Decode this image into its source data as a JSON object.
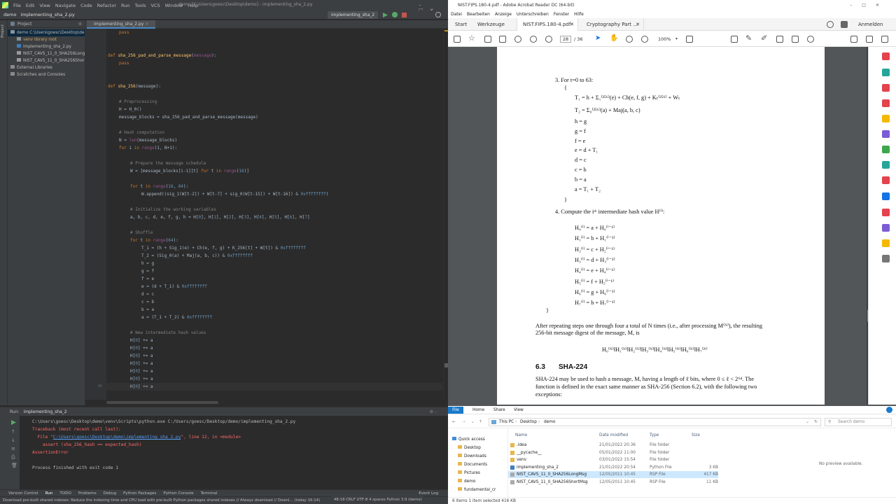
{
  "ide": {
    "menu": [
      "File",
      "Edit",
      "View",
      "Navigate",
      "Code",
      "Refactor",
      "Run",
      "Tools",
      "VCS",
      "Window",
      "Help"
    ],
    "window_title": "demo [C:\\Users\\goesc\\Desktop\\demo] - implementing_sha_2.py",
    "breadcrumb": [
      "demo",
      "implementing_sha_2.py"
    ],
    "project": {
      "header": "Project",
      "tree": [
        {
          "label": "demo  C:\\Users\\goesc\\Desktop\\demo",
          "indent": 0,
          "kind": "folder"
        },
        {
          "label": "venv  library root",
          "indent": 1,
          "kind": "folder"
        },
        {
          "label": "implementing_sha_2.py",
          "indent": 1,
          "kind": "py"
        },
        {
          "label": "NIST_CAVS_11_0_SHA256LongMsg.rsp",
          "indent": 1,
          "kind": "file"
        },
        {
          "label": "NIST_CAVS_11_0_SHA256ShortMsg.rsp",
          "indent": 1,
          "kind": "file"
        },
        {
          "label": "External Libraries",
          "indent": 0,
          "kind": "lib"
        },
        {
          "label": "Scratches and Consoles",
          "indent": 0,
          "kind": "lib"
        }
      ]
    },
    "editor_tab": "implementing_sha_2.py",
    "line_numbers": [
      "",
      "",
      "",
      "",
      "",
      "",
      "",
      "",
      "",
      "",
      "",
      "",
      "",
      "",
      "",
      "",
      "",
      "",
      "",
      "",
      "",
      "",
      "",
      "",
      "",
      "",
      "",
      "",
      "",
      "",
      "",
      "",
      "",
      "",
      "",
      "",
      "",
      "",
      "",
      "",
      "",
      "",
      "",
      "",
      "",
      "",
      "48"
    ],
    "code_lines": [
      {
        "indent": 1,
        "parts": [
          [
            "kw",
            "pass"
          ]
        ]
      },
      {
        "indent": 0,
        "parts": []
      },
      {
        "indent": 0,
        "parts": []
      },
      {
        "indent": 0,
        "parts": [
          [
            "kw",
            "def "
          ],
          [
            "fn",
            "sha_256_pad_and_parse_message"
          ],
          [
            "n",
            "("
          ],
          [
            "pr",
            "message"
          ],
          [
            "n",
            "):"
          ]
        ]
      },
      {
        "indent": 1,
        "parts": [
          [
            "kw",
            "pass"
          ]
        ]
      },
      {
        "indent": 0,
        "parts": []
      },
      {
        "indent": 0,
        "parts": []
      },
      {
        "indent": 0,
        "parts": [
          [
            "kw",
            "def "
          ],
          [
            "fn",
            "sha_256"
          ],
          [
            "n",
            "(message):"
          ]
        ]
      },
      {
        "indent": 0,
        "parts": []
      },
      {
        "indent": 1,
        "parts": [
          [
            "cm",
            "# Preprocessing"
          ]
        ]
      },
      {
        "indent": 1,
        "parts": [
          [
            "n",
            "H = H_0()"
          ]
        ]
      },
      {
        "indent": 1,
        "parts": [
          [
            "n",
            "message_blocks = sha_256_pad_and_parse_message(message)"
          ]
        ]
      },
      {
        "indent": 0,
        "parts": []
      },
      {
        "indent": 1,
        "parts": [
          [
            "cm",
            "# Hash computation"
          ]
        ]
      },
      {
        "indent": 1,
        "parts": [
          [
            "n",
            "N = "
          ],
          [
            "pr",
            "len"
          ],
          [
            "n",
            "(message_blocks)"
          ]
        ]
      },
      {
        "indent": 1,
        "parts": [
          [
            "kw",
            "for "
          ],
          [
            "n",
            "i "
          ],
          [
            "kw",
            "in "
          ],
          [
            "pr",
            "range"
          ],
          [
            "n",
            "(1, N+1):"
          ]
        ]
      },
      {
        "indent": 0,
        "parts": []
      },
      {
        "indent": 2,
        "parts": [
          [
            "cm",
            "# Prepare the message schedule"
          ]
        ]
      },
      {
        "indent": 2,
        "parts": [
          [
            "n",
            "W = [message_blocks[i-1][t] "
          ],
          [
            "kw",
            "for "
          ],
          [
            "n",
            "t "
          ],
          [
            "kw",
            "in "
          ],
          [
            "pr",
            "range"
          ],
          [
            "n",
            "("
          ],
          [
            "hx",
            "16"
          ],
          [
            "n",
            ")]"
          ]
        ]
      },
      {
        "indent": 0,
        "parts": []
      },
      {
        "indent": 2,
        "parts": [
          [
            "kw",
            "for "
          ],
          [
            "n",
            "t "
          ],
          [
            "kw",
            "in "
          ],
          [
            "pr",
            "range"
          ],
          [
            "n",
            "("
          ],
          [
            "hx",
            "16"
          ],
          [
            "n",
            ", "
          ],
          [
            "hx",
            "64"
          ],
          [
            "n",
            "):"
          ]
        ]
      },
      {
        "indent": 3,
        "parts": [
          [
            "n",
            "W.append((sig_1(W[t-2]) + W[t-7] + sig_0(W[t-15]) + W[t-16]) & "
          ],
          [
            "hx",
            "0xffffffff"
          ],
          [
            "n",
            ")"
          ]
        ]
      },
      {
        "indent": 0,
        "parts": []
      },
      {
        "indent": 2,
        "parts": [
          [
            "cm",
            "# Initialize the working variables"
          ]
        ]
      },
      {
        "indent": 2,
        "parts": [
          [
            "n",
            "a, b, c, d, e, f, g, h = H["
          ],
          [
            "hx",
            "0"
          ],
          [
            "n",
            "], H["
          ],
          [
            "hx",
            "1"
          ],
          [
            "n",
            "], H["
          ],
          [
            "hx",
            "2"
          ],
          [
            "n",
            "], H["
          ],
          [
            "hx",
            "3"
          ],
          [
            "n",
            "], H["
          ],
          [
            "hx",
            "4"
          ],
          [
            "n",
            "], H["
          ],
          [
            "hx",
            "5"
          ],
          [
            "n",
            "], H["
          ],
          [
            "hx",
            "6"
          ],
          [
            "n",
            "], H["
          ],
          [
            "hx",
            "7"
          ],
          [
            "n",
            "]"
          ]
        ]
      },
      {
        "indent": 0,
        "parts": []
      },
      {
        "indent": 2,
        "parts": [
          [
            "cm",
            "# Shuffle"
          ]
        ]
      },
      {
        "indent": 2,
        "parts": [
          [
            "kw",
            "for "
          ],
          [
            "n",
            "t "
          ],
          [
            "kw",
            "in "
          ],
          [
            "pr",
            "range"
          ],
          [
            "n",
            "("
          ],
          [
            "hx",
            "64"
          ],
          [
            "n",
            "):"
          ]
        ]
      },
      {
        "indent": 3,
        "parts": [
          [
            "n",
            "T_1 = (h + Sig_1(e) + Ch(e, f, g) + K_256[t] + W[t]) & "
          ],
          [
            "hx",
            "0xffffffff"
          ]
        ]
      },
      {
        "indent": 3,
        "parts": [
          [
            "n",
            "T_2 = (Sig_0(a) + Maj(a, b, c)) & "
          ],
          [
            "hx",
            "0xffffffff"
          ]
        ]
      },
      {
        "indent": 3,
        "parts": [
          [
            "n",
            "h = g"
          ]
        ]
      },
      {
        "indent": 3,
        "parts": [
          [
            "n",
            "g = f"
          ]
        ]
      },
      {
        "indent": 3,
        "parts": [
          [
            "n",
            "f = e"
          ]
        ]
      },
      {
        "indent": 3,
        "parts": [
          [
            "n",
            "e = (d + T_1) & "
          ],
          [
            "hx",
            "0xffffffff"
          ]
        ]
      },
      {
        "indent": 3,
        "parts": [
          [
            "n",
            "d = c"
          ]
        ]
      },
      {
        "indent": 3,
        "parts": [
          [
            "n",
            "c = b"
          ]
        ]
      },
      {
        "indent": 3,
        "parts": [
          [
            "n",
            "b = a"
          ]
        ]
      },
      {
        "indent": 3,
        "parts": [
          [
            "n",
            "a = (T_1 + T_2) & "
          ],
          [
            "hx",
            "0xffffffff"
          ]
        ]
      },
      {
        "indent": 0,
        "parts": []
      },
      {
        "indent": 2,
        "parts": [
          [
            "cm",
            "# New intermediate hash values"
          ]
        ]
      },
      {
        "indent": 2,
        "parts": [
          [
            "n",
            "H["
          ],
          [
            "hx",
            "0"
          ],
          [
            "n",
            "] += a"
          ]
        ]
      },
      {
        "indent": 2,
        "parts": [
          [
            "n",
            "H["
          ],
          [
            "hx",
            "0"
          ],
          [
            "n",
            "] += a"
          ]
        ]
      },
      {
        "indent": 2,
        "parts": [
          [
            "n",
            "H["
          ],
          [
            "hx",
            "0"
          ],
          [
            "n",
            "] += a"
          ]
        ]
      },
      {
        "indent": 2,
        "parts": [
          [
            "n",
            "H["
          ],
          [
            "hx",
            "0"
          ],
          [
            "n",
            "] += a"
          ]
        ]
      },
      {
        "indent": 2,
        "parts": [
          [
            "n",
            "H["
          ],
          [
            "hx",
            "0"
          ],
          [
            "n",
            "] += a"
          ]
        ]
      },
      {
        "indent": 2,
        "parts": [
          [
            "n",
            "H["
          ],
          [
            "hx",
            "0"
          ],
          [
            "n",
            "] += a"
          ]
        ]
      },
      {
        "indent": 2,
        "parts": [
          [
            "n",
            "H["
          ],
          [
            "hx",
            "0"
          ],
          [
            "n",
            "] += a"
          ]
        ]
      }
    ],
    "run": {
      "label": "Run:",
      "config": "implementing_sha_2",
      "command": "C:\\Users\\goesc\\Desktop\\demo\\venv\\Scripts\\python.exe C:/Users/goesc/Desktop/demo/implementing_sha_2.py",
      "tb1": "Traceback (most recent call last):",
      "tb2_pre": "  File \"",
      "tb2_link": "C:\\Users\\goesc\\Desktop\\demo\\implementing_sha_2.py",
      "tb2_post": "\", line 12, in <module>",
      "tb3": "    assert (sha_256_hash == expected_hash)",
      "tb4": "AssertionError",
      "finished": "Process finished with exit code 1"
    },
    "bottom_tools": [
      "Version Control",
      "Run",
      "TODO",
      "Problems",
      "Debug",
      "Python Packages",
      "Python Console",
      "Terminal",
      "Event Log"
    ],
    "status_left": "Download pre-built shared indexes: Reduce the indexing time and CPU load with pre-built Python packages shared indexes // Always download // Downl... (today 16:14)",
    "status_right": "48:18  CRLF  UTF-8  4 spaces  Python 3.9 (demo)"
  },
  "acrobat": {
    "title": "NIST.FIPS.180-4.pdf - Adobe Acrobat Reader DC (64-bit)",
    "menu": [
      "Datei",
      "Bearbeiten",
      "Anzeige",
      "Unterschreiben",
      "Fenster",
      "Hilfe"
    ],
    "tabs": [
      "Start",
      "Werkzeuge",
      "NIST.FIPS.180-4.pdf",
      "Cryptography Part ..."
    ],
    "signin": "Anmelden",
    "page_current": "28",
    "page_total": "/ 36",
    "zoom": "100%",
    "doc": {
      "step3": "3.   For t=0 to 63:",
      "brace_open": "{",
      "t1": "T₁ = h + Σ₁⁽²⁵⁶⁾(e) + Ch(e, f, g) + Kₜ⁽²⁵⁶⁾ + Wₜ",
      "t2": "T₂ = Σ₀⁽²⁵⁶⁾(a) + Maj(a, b, c)",
      "assign": [
        "h = g",
        "g = f",
        "f = e",
        "e = d + T₁",
        "d = c",
        "c = b",
        "b = a",
        "a = T₁ + T₂"
      ],
      "brace_close": "}",
      "step4": "4.   Compute the iᵗʰ intermediate hash value H⁽ⁱ⁾:",
      "hvals": [
        "H₀⁽ⁱ⁾ = a + H₀⁽ⁱ⁻¹⁾",
        "H₁⁽ⁱ⁾ = b + H₁⁽ⁱ⁻¹⁾",
        "H₂⁽ⁱ⁾ = c + H₂⁽ⁱ⁻¹⁾",
        "H₃⁽ⁱ⁾ = d + H₃⁽ⁱ⁻¹⁾",
        "H₄⁽ⁱ⁾ = e + H₄⁽ⁱ⁻¹⁾",
        "H₅⁽ⁱ⁾ = f + H₅⁽ⁱ⁻¹⁾",
        "H₆⁽ⁱ⁾ = g + H₆⁽ⁱ⁻¹⁾",
        "H₇⁽ⁱ⁾ = h + H₇⁽ⁱ⁻¹⁾"
      ],
      "outer_close": "}",
      "after1": "After repeating steps one through four a total of N times (i.e., after processing M⁽ᴺ⁾), the resulting",
      "after2": "256-bit message digest of the message, M, is",
      "digest": "H₀⁽ᴺ⁾‖H₁⁽ᴺ⁾‖H₂⁽ᴺ⁾‖H₃⁽ᴺ⁾‖H₄⁽ᴺ⁾‖H₅⁽ᴺ⁾‖H₆⁽ᴺ⁾‖H₇⁽ᴺ⁾",
      "sec_num": "6.3",
      "sec_title": "SHA-224",
      "p1": "SHA-224 may be used to hash a message, M, having a length of ℓ bits, where  0 ≤ ℓ < 2⁶⁴. The",
      "p2": "function is defined in the exact same manner as SHA-256 (Section 6.2), with the following two",
      "p3": "exceptions:"
    }
  },
  "explorer": {
    "ribbon": [
      "File",
      "Home",
      "Share",
      "View"
    ],
    "path": [
      "This PC",
      "Desktop",
      "demo"
    ],
    "search_placeholder": "Search demo",
    "columns": [
      "Name",
      "Date modified",
      "Type",
      "Size"
    ],
    "nav": [
      "Quick access",
      "Desktop",
      "Downloads",
      "Documents",
      "Pictures",
      "demo",
      "fundamental_cr"
    ],
    "files": [
      {
        "name": ".idea",
        "date": "21/01/2022 20:36",
        "type": "File folder",
        "size": ""
      },
      {
        "name": "__pycache__",
        "date": "05/01/2022 11:00",
        "type": "File folder",
        "size": ""
      },
      {
        "name": "venv",
        "date": "03/01/2022 15:54",
        "type": "File folder",
        "size": ""
      },
      {
        "name": "implementing_sha_2",
        "date": "21/01/2022 20:54",
        "type": "Python File",
        "size": "3 KB"
      },
      {
        "name": "NIST_CAVS_11_0_SHA256LongMsg",
        "date": "12/05/2011 10:45",
        "type": "RSP File",
        "size": "417 KB"
      },
      {
        "name": "NIST_CAVS_11_0_SHA256ShortMsg",
        "date": "12/05/2011 10:45",
        "type": "RSP File",
        "size": "11 KB"
      }
    ],
    "preview": "No preview available.",
    "status": "6 items    1 item selected  416 KB"
  }
}
